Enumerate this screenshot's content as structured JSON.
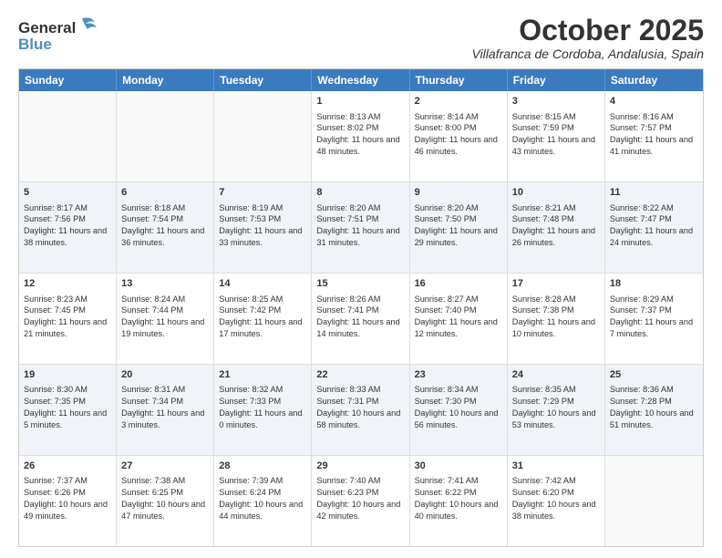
{
  "header": {
    "logo_line1": "General",
    "logo_line2": "Blue",
    "month": "October 2025",
    "location": "Villafranca de Cordoba, Andalusia, Spain"
  },
  "days_of_week": [
    "Sunday",
    "Monday",
    "Tuesday",
    "Wednesday",
    "Thursday",
    "Friday",
    "Saturday"
  ],
  "weeks": [
    [
      {
        "day": "",
        "content": ""
      },
      {
        "day": "",
        "content": ""
      },
      {
        "day": "",
        "content": ""
      },
      {
        "day": "1",
        "content": "Sunrise: 8:13 AM\nSunset: 8:02 PM\nDaylight: 11 hours and 48 minutes."
      },
      {
        "day": "2",
        "content": "Sunrise: 8:14 AM\nSunset: 8:00 PM\nDaylight: 11 hours and 46 minutes."
      },
      {
        "day": "3",
        "content": "Sunrise: 8:15 AM\nSunset: 7:59 PM\nDaylight: 11 hours and 43 minutes."
      },
      {
        "day": "4",
        "content": "Sunrise: 8:16 AM\nSunset: 7:57 PM\nDaylight: 11 hours and 41 minutes."
      }
    ],
    [
      {
        "day": "5",
        "content": "Sunrise: 8:17 AM\nSunset: 7:56 PM\nDaylight: 11 hours and 38 minutes."
      },
      {
        "day": "6",
        "content": "Sunrise: 8:18 AM\nSunset: 7:54 PM\nDaylight: 11 hours and 36 minutes."
      },
      {
        "day": "7",
        "content": "Sunrise: 8:19 AM\nSunset: 7:53 PM\nDaylight: 11 hours and 33 minutes."
      },
      {
        "day": "8",
        "content": "Sunrise: 8:20 AM\nSunset: 7:51 PM\nDaylight: 11 hours and 31 minutes."
      },
      {
        "day": "9",
        "content": "Sunrise: 8:20 AM\nSunset: 7:50 PM\nDaylight: 11 hours and 29 minutes."
      },
      {
        "day": "10",
        "content": "Sunrise: 8:21 AM\nSunset: 7:48 PM\nDaylight: 11 hours and 26 minutes."
      },
      {
        "day": "11",
        "content": "Sunrise: 8:22 AM\nSunset: 7:47 PM\nDaylight: 11 hours and 24 minutes."
      }
    ],
    [
      {
        "day": "12",
        "content": "Sunrise: 8:23 AM\nSunset: 7:45 PM\nDaylight: 11 hours and 21 minutes."
      },
      {
        "day": "13",
        "content": "Sunrise: 8:24 AM\nSunset: 7:44 PM\nDaylight: 11 hours and 19 minutes."
      },
      {
        "day": "14",
        "content": "Sunrise: 8:25 AM\nSunset: 7:42 PM\nDaylight: 11 hours and 17 minutes."
      },
      {
        "day": "15",
        "content": "Sunrise: 8:26 AM\nSunset: 7:41 PM\nDaylight: 11 hours and 14 minutes."
      },
      {
        "day": "16",
        "content": "Sunrise: 8:27 AM\nSunset: 7:40 PM\nDaylight: 11 hours and 12 minutes."
      },
      {
        "day": "17",
        "content": "Sunrise: 8:28 AM\nSunset: 7:38 PM\nDaylight: 11 hours and 10 minutes."
      },
      {
        "day": "18",
        "content": "Sunrise: 8:29 AM\nSunset: 7:37 PM\nDaylight: 11 hours and 7 minutes."
      }
    ],
    [
      {
        "day": "19",
        "content": "Sunrise: 8:30 AM\nSunset: 7:35 PM\nDaylight: 11 hours and 5 minutes."
      },
      {
        "day": "20",
        "content": "Sunrise: 8:31 AM\nSunset: 7:34 PM\nDaylight: 11 hours and 3 minutes."
      },
      {
        "day": "21",
        "content": "Sunrise: 8:32 AM\nSunset: 7:33 PM\nDaylight: 11 hours and 0 minutes."
      },
      {
        "day": "22",
        "content": "Sunrise: 8:33 AM\nSunset: 7:31 PM\nDaylight: 10 hours and 58 minutes."
      },
      {
        "day": "23",
        "content": "Sunrise: 8:34 AM\nSunset: 7:30 PM\nDaylight: 10 hours and 56 minutes."
      },
      {
        "day": "24",
        "content": "Sunrise: 8:35 AM\nSunset: 7:29 PM\nDaylight: 10 hours and 53 minutes."
      },
      {
        "day": "25",
        "content": "Sunrise: 8:36 AM\nSunset: 7:28 PM\nDaylight: 10 hours and 51 minutes."
      }
    ],
    [
      {
        "day": "26",
        "content": "Sunrise: 7:37 AM\nSunset: 6:26 PM\nDaylight: 10 hours and 49 minutes."
      },
      {
        "day": "27",
        "content": "Sunrise: 7:38 AM\nSunset: 6:25 PM\nDaylight: 10 hours and 47 minutes."
      },
      {
        "day": "28",
        "content": "Sunrise: 7:39 AM\nSunset: 6:24 PM\nDaylight: 10 hours and 44 minutes."
      },
      {
        "day": "29",
        "content": "Sunrise: 7:40 AM\nSunset: 6:23 PM\nDaylight: 10 hours and 42 minutes."
      },
      {
        "day": "30",
        "content": "Sunrise: 7:41 AM\nSunset: 6:22 PM\nDaylight: 10 hours and 40 minutes."
      },
      {
        "day": "31",
        "content": "Sunrise: 7:42 AM\nSunset: 6:20 PM\nDaylight: 10 hours and 38 minutes."
      },
      {
        "day": "",
        "content": ""
      }
    ]
  ]
}
